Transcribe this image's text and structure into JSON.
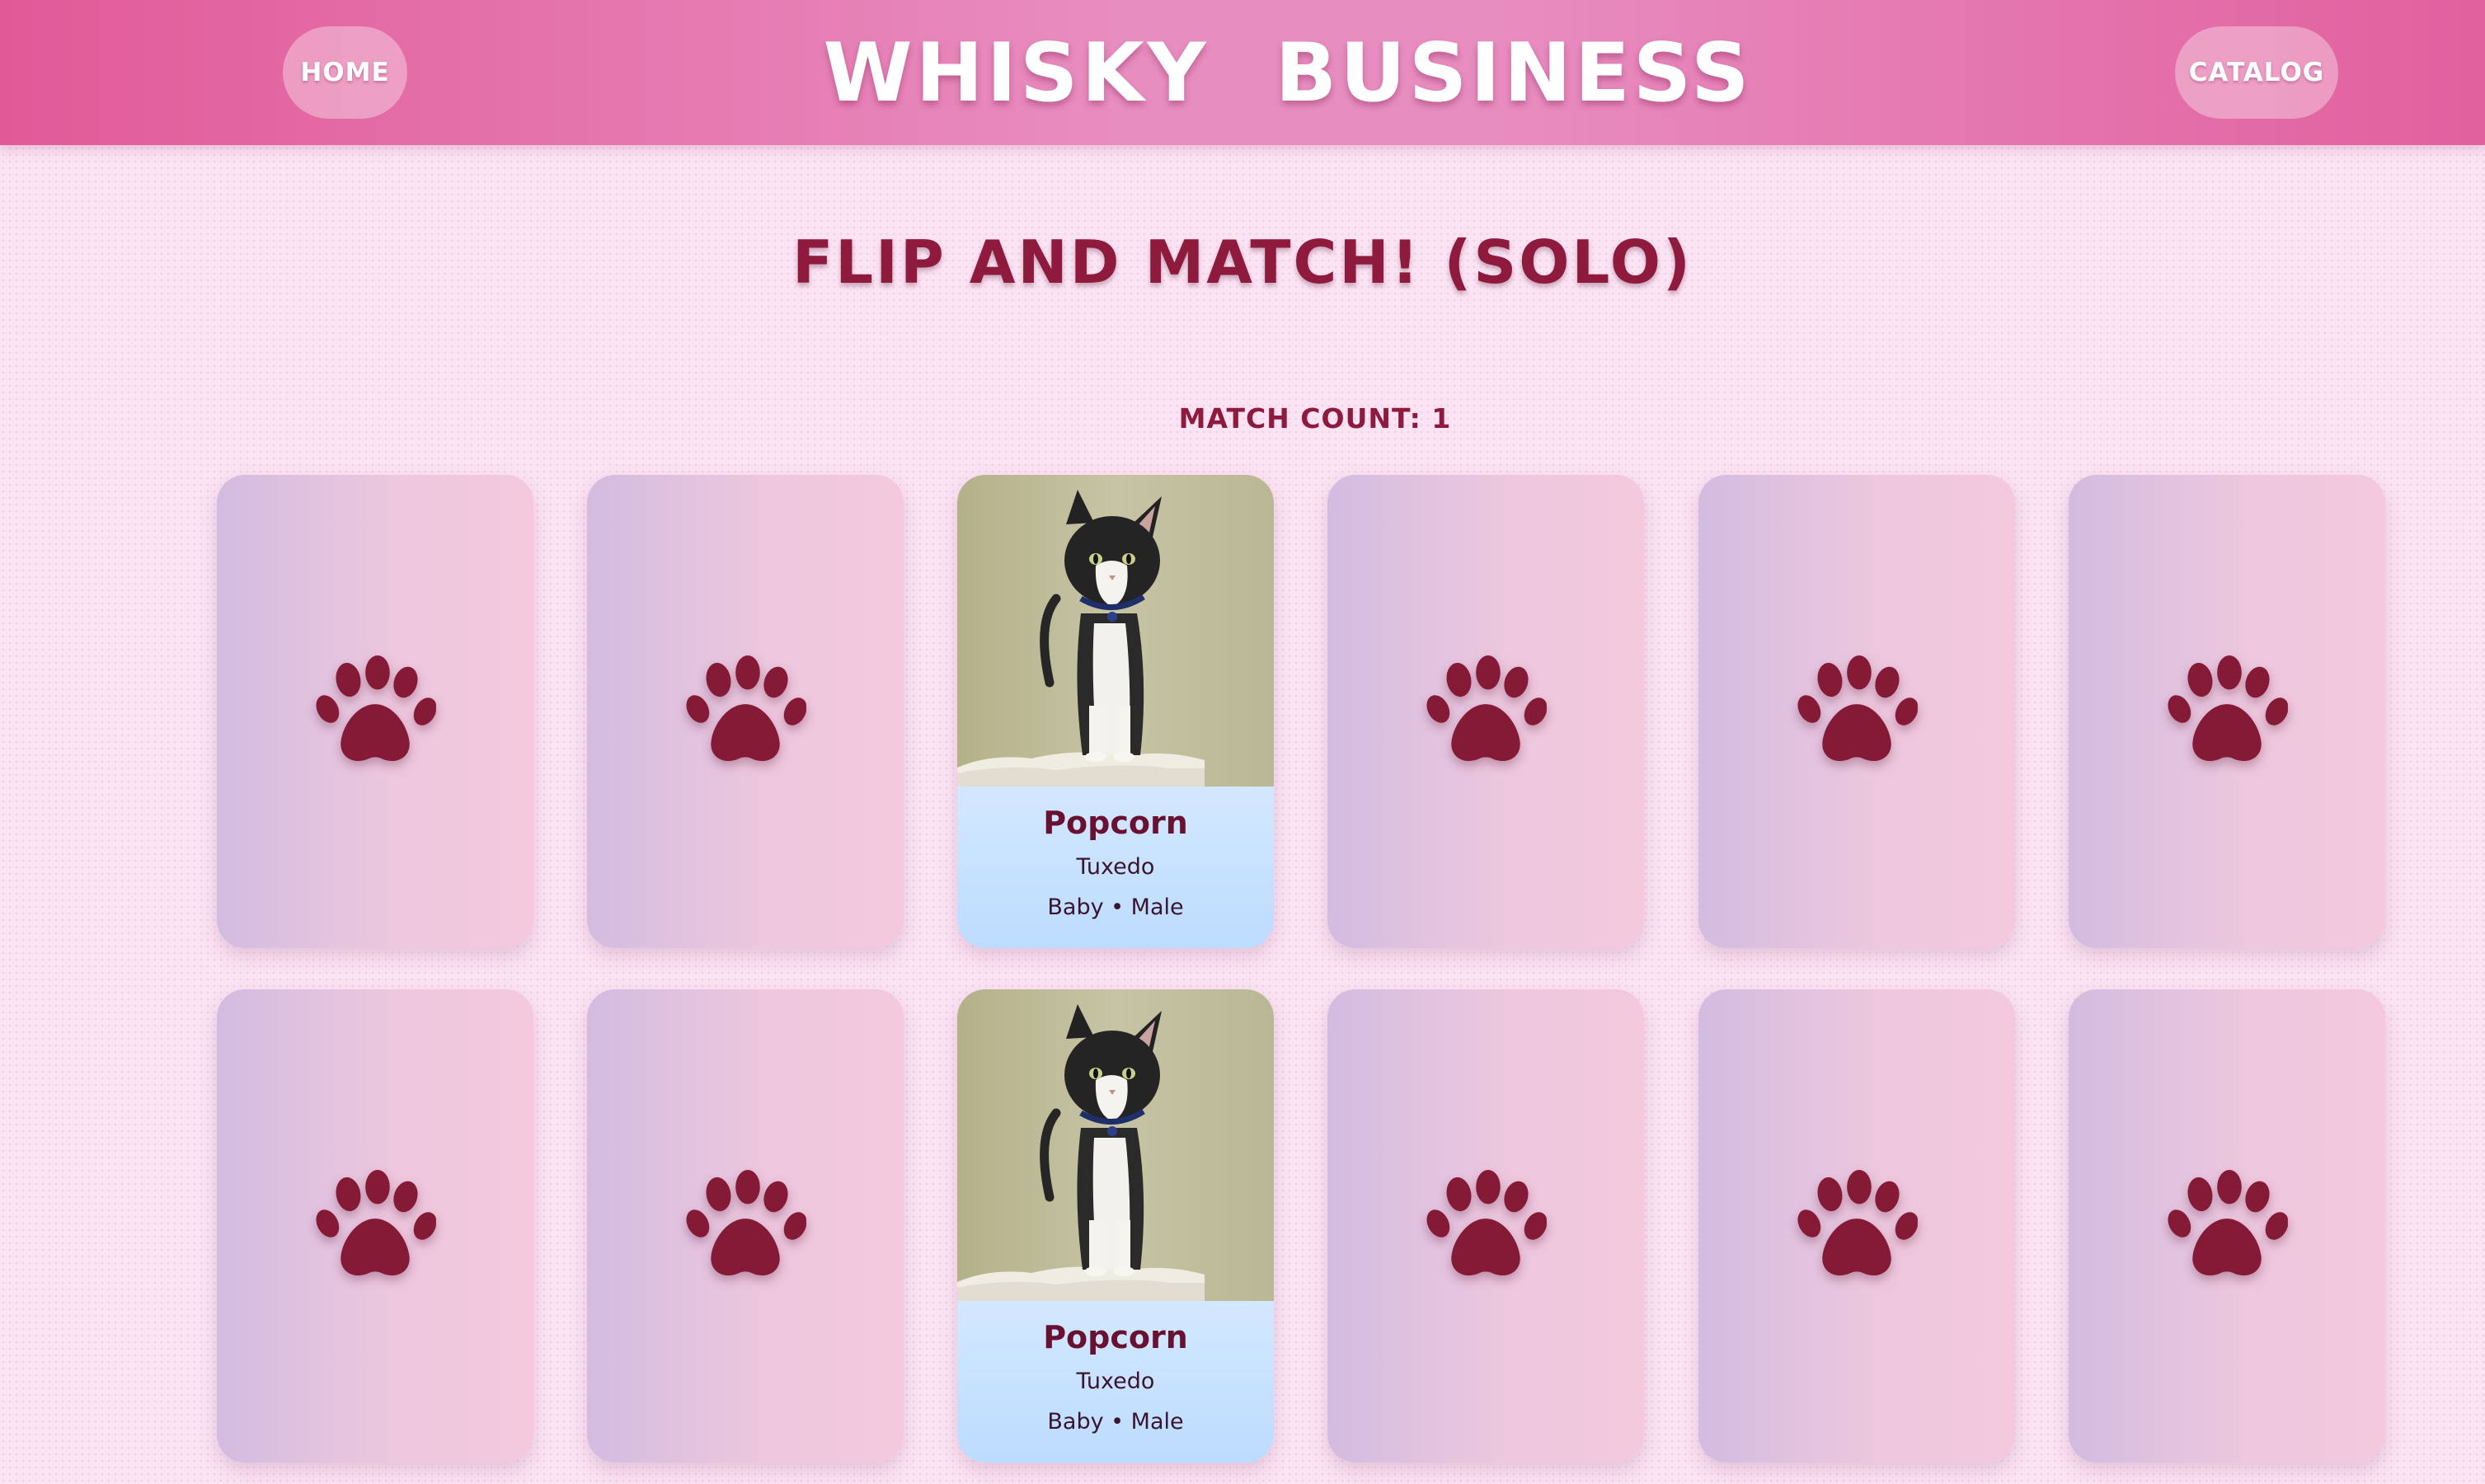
{
  "header": {
    "brand_left": "WHISKY",
    "brand_right": "BUSINESS",
    "brand_icon": "paw-icon",
    "nav_home": "HOME",
    "nav_catalog": "CATALOG"
  },
  "game": {
    "title": "FLIP AND MATCH! (SOLO)",
    "match_count": "MATCH COUNT: 1"
  },
  "cards": [
    {
      "state": "face-down",
      "icon": "paw-icon"
    },
    {
      "state": "face-down",
      "icon": "paw-icon"
    },
    {
      "state": "face-up",
      "name": "Popcorn",
      "breed": "Tuxedo",
      "meta": "Baby • Male"
    },
    {
      "state": "face-down",
      "icon": "paw-icon"
    },
    {
      "state": "face-down",
      "icon": "paw-icon"
    },
    {
      "state": "face-down",
      "icon": "paw-icon"
    },
    {
      "state": "face-down",
      "icon": "paw-icon"
    },
    {
      "state": "face-down",
      "icon": "paw-icon"
    },
    {
      "state": "face-up",
      "name": "Popcorn",
      "breed": "Tuxedo",
      "meta": "Baby • Male"
    },
    {
      "state": "face-down",
      "icon": "paw-icon"
    },
    {
      "state": "face-down",
      "icon": "paw-icon"
    },
    {
      "state": "face-down",
      "icon": "paw-icon"
    }
  ],
  "colors": {
    "header": "#e88dc0",
    "accent": "#8e1a3d",
    "card_back": "#ecc7de",
    "page_bg": "#fbe3f3"
  }
}
